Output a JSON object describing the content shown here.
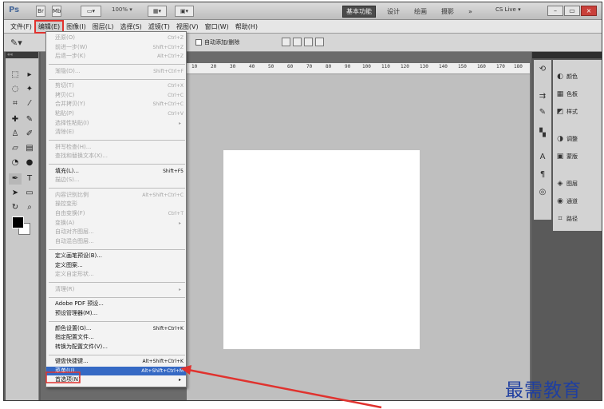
{
  "titlebar": {
    "app_logo": "Ps",
    "zoom": "100% ▾",
    "workspaces": [
      "基本功能",
      "设计",
      "绘画",
      "摄影",
      "»"
    ],
    "cs_live": "CS Live ▾",
    "window_buttons": [
      "–",
      "▭",
      "×"
    ]
  },
  "menubar": {
    "items": [
      "文件(F)",
      "编辑(E)",
      "图像(I)",
      "图层(L)",
      "选择(S)",
      "滤镜(T)",
      "视图(V)",
      "窗口(W)",
      "帮助(H)"
    ]
  },
  "optionsbar": {
    "auto_add_label": "自动添加/删除"
  },
  "ruler": {
    "numbers": [
      "10",
      "20",
      "30",
      "40",
      "50",
      "60",
      "70",
      "80",
      "90",
      "100",
      "110",
      "120",
      "130",
      "140",
      "150",
      "160",
      "170",
      "180"
    ]
  },
  "right_panel": {
    "items": [
      "颜色",
      "色板",
      "样式",
      "调整",
      "蒙版",
      "图层",
      "通道",
      "路径"
    ]
  },
  "edit_menu": {
    "rows": [
      {
        "label": "还原(O)",
        "shortcut": "Ctrl+Z",
        "state": "disabled"
      },
      {
        "label": "前进一步(W)",
        "shortcut": "Shift+Ctrl+Z",
        "state": "disabled"
      },
      {
        "label": "后退一步(K)",
        "shortcut": "Alt+Ctrl+Z",
        "state": "disabled"
      },
      {
        "sep": true
      },
      {
        "label": "渐隐(D)...",
        "shortcut": "Shift+Ctrl+F",
        "state": "disabled"
      },
      {
        "sep": true
      },
      {
        "label": "剪切(T)",
        "shortcut": "Ctrl+X",
        "state": "disabled"
      },
      {
        "label": "拷贝(C)",
        "shortcut": "Ctrl+C",
        "state": "disabled"
      },
      {
        "label": "合并拷贝(Y)",
        "shortcut": "Shift+Ctrl+C",
        "state": "disabled"
      },
      {
        "label": "粘贴(P)",
        "shortcut": "Ctrl+V",
        "state": "disabled"
      },
      {
        "label": "选择性粘贴(I)",
        "shortcut": "",
        "state": "disabled",
        "submenu": true
      },
      {
        "label": "清除(E)",
        "shortcut": "",
        "state": "disabled"
      },
      {
        "sep": true
      },
      {
        "label": "拼写检查(H)...",
        "shortcut": "",
        "state": "disabled"
      },
      {
        "label": "查找和替换文本(X)...",
        "shortcut": "",
        "state": "disabled"
      },
      {
        "sep": true
      },
      {
        "label": "填充(L)...",
        "shortcut": "Shift+F5",
        "state": "enabled"
      },
      {
        "label": "描边(S)...",
        "shortcut": "",
        "state": "disabled"
      },
      {
        "sep": true
      },
      {
        "label": "内容识别比例",
        "shortcut": "Alt+Shift+Ctrl+C",
        "state": "disabled"
      },
      {
        "label": "操控变形",
        "shortcut": "",
        "state": "disabled"
      },
      {
        "label": "自由变换(F)",
        "shortcut": "Ctrl+T",
        "state": "disabled"
      },
      {
        "label": "变换(A)",
        "shortcut": "",
        "state": "disabled",
        "submenu": true
      },
      {
        "label": "自动对齐图层...",
        "shortcut": "",
        "state": "disabled"
      },
      {
        "label": "自动混合图层...",
        "shortcut": "",
        "state": "disabled"
      },
      {
        "sep": true
      },
      {
        "label": "定义画笔预设(B)...",
        "shortcut": "",
        "state": "enabled"
      },
      {
        "label": "定义图案...",
        "shortcut": "",
        "state": "enabled"
      },
      {
        "label": "定义自定形状...",
        "shortcut": "",
        "state": "disabled"
      },
      {
        "sep": true
      },
      {
        "label": "清理(R)",
        "shortcut": "",
        "state": "disabled",
        "submenu": true
      },
      {
        "sep": true
      },
      {
        "label": "Adobe PDF 预设...",
        "shortcut": "",
        "state": "enabled"
      },
      {
        "label": "预设管理器(M)...",
        "shortcut": "",
        "state": "enabled"
      },
      {
        "sep": true
      },
      {
        "label": "颜色设置(G)...",
        "shortcut": "Shift+Ctrl+K",
        "state": "enabled"
      },
      {
        "label": "指定配置文件...",
        "shortcut": "",
        "state": "enabled"
      },
      {
        "label": "转换为配置文件(V)...",
        "shortcut": "",
        "state": "enabled"
      },
      {
        "sep": true
      },
      {
        "label": "键盘快捷键...",
        "shortcut": "Alt+Shift+Ctrl+K",
        "state": "enabled"
      },
      {
        "label": "菜单(U)...",
        "shortcut": "Alt+Shift+Ctrl+M",
        "state": "highlighted"
      },
      {
        "label": "首选项(N)",
        "shortcut": "",
        "state": "enabled",
        "submenu": true
      }
    ]
  },
  "watermark": "最需教育",
  "colors": {
    "highlight": "#3569c4",
    "annotation_red": "#e0322e",
    "watermark": "#1f3fa0"
  }
}
